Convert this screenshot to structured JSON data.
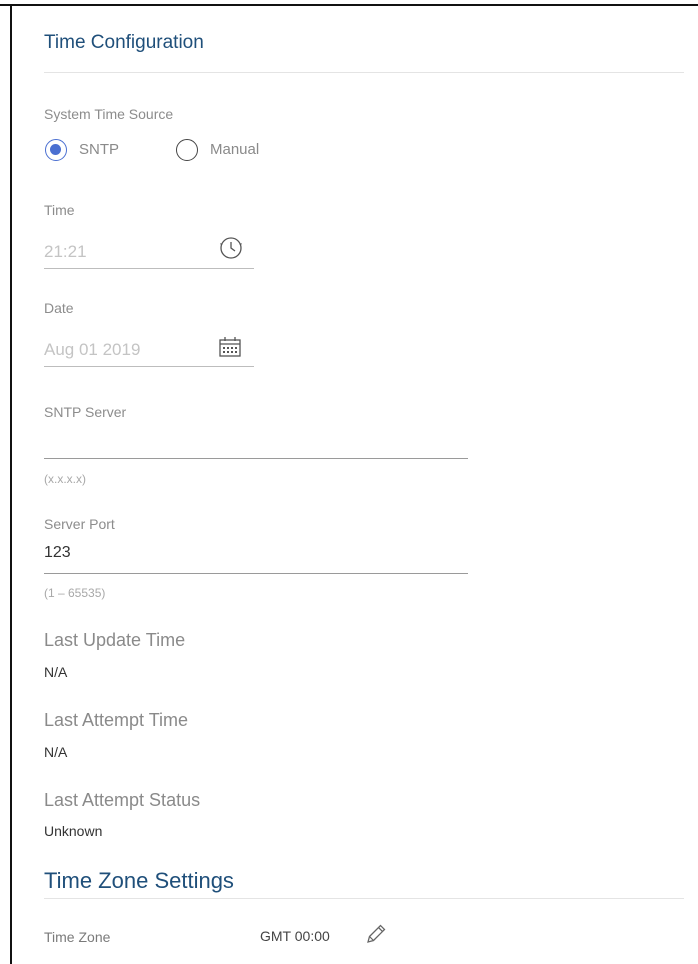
{
  "page": {
    "title": "Time Configuration"
  },
  "time_source": {
    "label": "System Time Source",
    "options": [
      {
        "label": "SNTP",
        "checked": true
      },
      {
        "label": "Manual",
        "checked": false
      }
    ]
  },
  "time": {
    "label": "Time",
    "value": "21:21",
    "icon": "clock-icon"
  },
  "date": {
    "label": "Date",
    "value": "Aug 01 2019",
    "icon": "calendar-icon"
  },
  "sntp_server": {
    "label": "SNTP Server",
    "value": "",
    "hint": "(x.x.x.x)"
  },
  "server_port": {
    "label": "Server Port",
    "value": "123",
    "hint": "(1 – 65535)"
  },
  "last_update": {
    "label": "Last Update Time",
    "value": "N/A"
  },
  "last_attempt": {
    "label": "Last Attempt Time",
    "value": "N/A"
  },
  "last_status": {
    "label": "Last Attempt Status",
    "value": "Unknown"
  },
  "time_zone": {
    "section_title": "Time Zone Settings",
    "label": "Time Zone",
    "value": "GMT 00:00",
    "edit_icon": "pencil-icon"
  },
  "colors": {
    "accent": "#4a6fd1",
    "title": "#1f4f7a"
  }
}
